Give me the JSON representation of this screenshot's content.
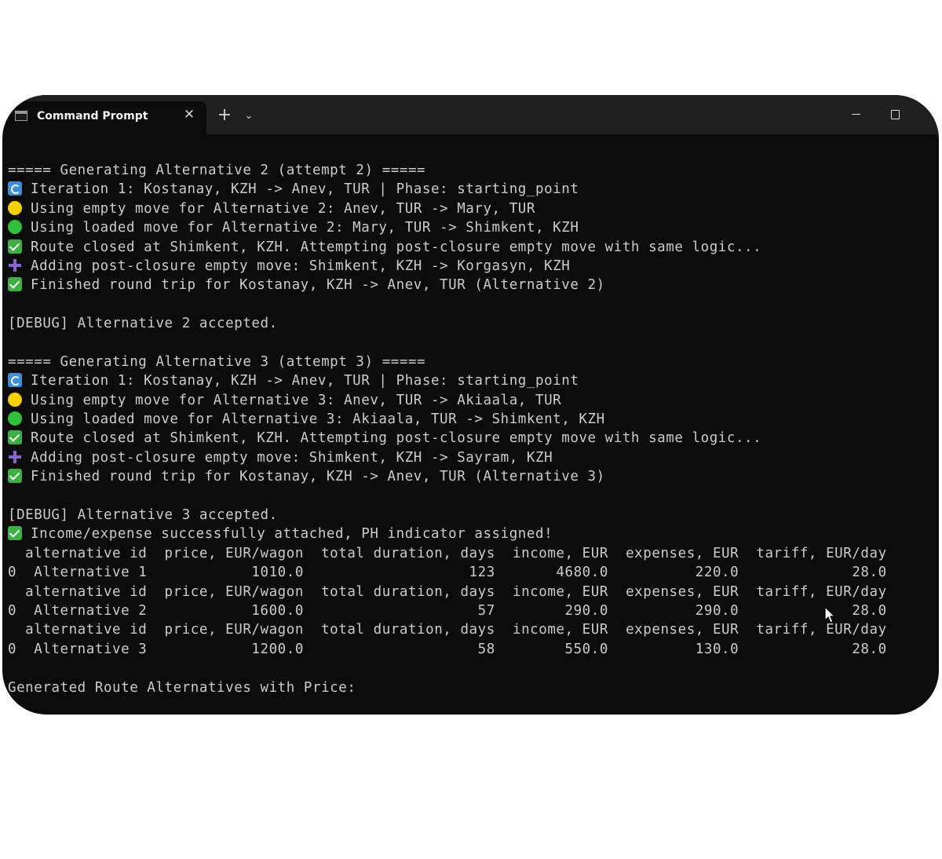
{
  "window": {
    "tab_title": "Command Prompt",
    "tab_close_glyph": "✕",
    "new_tab_glyph": "+",
    "dropdown_glyph": "⌄"
  },
  "console": {
    "lines": [
      {
        "text": "===== Generating Alternative 2 (attempt 2) ====="
      },
      {
        "icon": "refresh-icon",
        "text": "Iteration 1: Kostanay, KZH -> Anev, TUR | Phase: starting_point"
      },
      {
        "icon": "yellow-circle-icon",
        "text": "Using empty move for Alternative 2: Anev, TUR -> Mary, TUR"
      },
      {
        "icon": "green-circle-icon",
        "text": "Using loaded move for Alternative 2: Mary, TUR -> Shimkent, KZH"
      },
      {
        "icon": "check-mark-icon",
        "text": "Route closed at Shimkent, KZH. Attempting post-closure empty move with same logic..."
      },
      {
        "icon": "plus-icon",
        "text": "Adding post-closure empty move: Shimkent, KZH -> Korgasyn, KZH"
      },
      {
        "icon": "check-mark-icon",
        "text": "Finished round trip for Kostanay, KZH -> Anev, TUR (Alternative 2)"
      },
      {
        "text": ""
      },
      {
        "text": "[DEBUG] Alternative 2 accepted."
      },
      {
        "text": ""
      },
      {
        "text": "===== Generating Alternative 3 (attempt 3) ====="
      },
      {
        "icon": "refresh-icon",
        "text": "Iteration 1: Kostanay, KZH -> Anev, TUR | Phase: starting_point"
      },
      {
        "icon": "yellow-circle-icon",
        "text": "Using empty move for Alternative 3: Anev, TUR -> Akiaala, TUR"
      },
      {
        "icon": "green-circle-icon",
        "text": "Using loaded move for Alternative 3: Akiaala, TUR -> Shimkent, KZH"
      },
      {
        "icon": "check-mark-icon",
        "text": "Route closed at Shimkent, KZH. Attempting post-closure empty move with same logic..."
      },
      {
        "icon": "plus-icon",
        "text": "Adding post-closure empty move: Shimkent, KZH -> Sayram, KZH"
      },
      {
        "icon": "check-mark-icon",
        "text": "Finished round trip for Kostanay, KZH -> Anev, TUR (Alternative 3)"
      },
      {
        "text": ""
      },
      {
        "text": "[DEBUG] Alternative 3 accepted."
      },
      {
        "icon": "check-mark-icon",
        "text": "Income/expense successfully attached, PH indicator assigned!"
      },
      {
        "text": "  alternative id  price, EUR/wagon  total duration, days  income, EUR  expenses, EUR  tariff, EUR/day"
      },
      {
        "text": "0  Alternative 1            1010.0                   123       4680.0          220.0             28.0"
      },
      {
        "text": "  alternative id  price, EUR/wagon  total duration, days  income, EUR  expenses, EUR  tariff, EUR/day"
      },
      {
        "text": "0  Alternative 2            1600.0                    57        290.0          290.0             28.0"
      },
      {
        "text": "  alternative id  price, EUR/wagon  total duration, days  income, EUR  expenses, EUR  tariff, EUR/day"
      },
      {
        "text": "0  Alternative 3            1200.0                    58        550.0          130.0             28.0"
      },
      {
        "text": ""
      },
      {
        "text": "Generated Route Alternatives with Price:"
      }
    ]
  }
}
